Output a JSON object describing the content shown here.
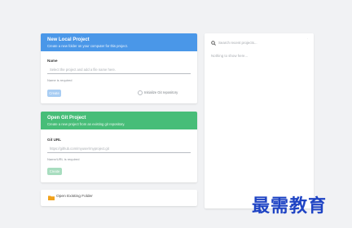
{
  "local_project": {
    "title": "New Local Project",
    "description": "Create a new folder on your computer for this project.",
    "name_label": "Name",
    "name_placeholder": "Select the project and add a file name here.",
    "name_hint": "Name is required",
    "create_label": "Create",
    "checkbox_label": "Initialize Git repository"
  },
  "git_project": {
    "title": "Open Git Project",
    "description": "Create a new project from an existing git repository.",
    "url_label": "Git URL",
    "url_placeholder": "https://github.com/myuser/myproject.git",
    "url_hint": "Name/URL is required",
    "create_label": "Create"
  },
  "open_folder": {
    "label": "Open Existing Folder"
  },
  "recent": {
    "search_placeholder": "Search recent projects...",
    "empty_text": "Nothing to show here...",
    "dot": "·"
  },
  "watermark": "最需教育",
  "colors": {
    "local_header": "#4a97e8",
    "git_header": "#47bd78",
    "folder_icon": "#f1a21c",
    "watermark": "#1f44c4"
  },
  "icons": {
    "search": "search-icon",
    "folder": "folder-icon",
    "checkbox": "checkbox-icon"
  }
}
